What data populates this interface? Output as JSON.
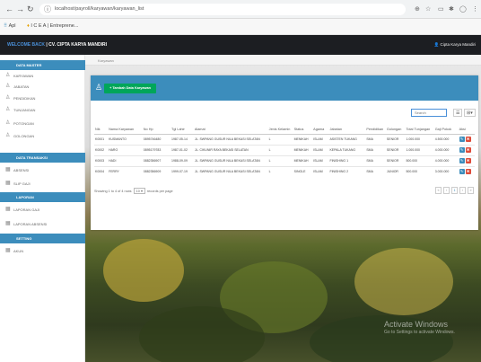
{
  "browser": {
    "url": "localhost/payroll/karyawan/karyawan_list",
    "bookmarks": [
      "Apl",
      "I C E A | Entreprene..."
    ]
  },
  "header": {
    "welcome": "WELCOME BACK",
    "company": "CV. CIPTA KARYA MANDIRI",
    "user": "Cipta Karya Mandiri"
  },
  "sidebar": {
    "sections": [
      {
        "label": "DATA MASTER",
        "items": [
          "KARYAWAN",
          "JABATAN",
          "PENDIDIKAN",
          "TUNJANGAN",
          "POTONGAN",
          "GOLONGAN"
        ]
      },
      {
        "label": "DATA TRANSAKSI",
        "items": [
          "ABSENSI",
          "SLIP GAJI"
        ]
      },
      {
        "label": "LAPORAN",
        "items": [
          "LAPORAN GAJI",
          "LAPORAN ABSENSI"
        ]
      },
      {
        "label": "SETTING",
        "items": [
          "AKUN"
        ]
      }
    ]
  },
  "breadcrumb": "Karyawan",
  "toolbar": {
    "add_label": "+ Tambah Data Karyawan",
    "search_placeholder": "Search"
  },
  "table": {
    "columns": [
      "Nik",
      "Nama Karyawan",
      "No Hp",
      "Tgl Lahir",
      "Alamat",
      "Jenis Kelamin",
      "Status",
      "Agama",
      "Jabatan",
      "Pendidikan",
      "Golongan",
      "Total Tunjangan",
      "Gaji Pokok",
      "Aksi"
    ],
    "rows": [
      [
        "K0001",
        "KUSMANTO",
        "0895746480",
        "1987-05-14",
        "JL. SWPANG GUSUR NILA BEKASI SELATAN",
        "L",
        "MENIKAH",
        "ISLAM",
        "ASISTEN TUKANG",
        "SMA",
        "SENIOR",
        "1.000.000",
        "4.500.000"
      ],
      [
        "K0002",
        "HARO",
        "0895179783",
        "1987-01-02",
        "JL. CIKUNIR RAYA BEKASI SELATAN",
        "L",
        "MENIKAH",
        "ISLAM",
        "KEPALA TUKANG",
        "SMA",
        "SENIOR",
        "1.000.000",
        "4.000.000"
      ],
      [
        "K0003",
        "HADI",
        "0882356907",
        "1988-09-09",
        "JL. SWPANG GUSUR NILA BEKASI SELATAN",
        "L",
        "MENIKAH",
        "ISLAM",
        "FINISHING 1",
        "SMA",
        "SENIOR",
        "500.000",
        "4.000.000"
      ],
      [
        "K0004",
        "FERRY",
        "0882356909",
        "1999-07-19",
        "JL. SWPANG GUSUR NILA BEKASI SELATAN",
        "L",
        "SINGLE",
        "ISLAM",
        "FINISHING 2",
        "SMA",
        "JUNIOR",
        "500.000",
        "3.000.000"
      ]
    ]
  },
  "footer": {
    "info_prefix": "Showing 1 to 4 of 4 rows",
    "page_size": "10",
    "info_suffix": "records per page",
    "pager": [
      "«",
      "‹",
      "1",
      "›",
      "»"
    ]
  },
  "watermark": {
    "line1": "Activate Windows",
    "line2": "Go to Settings to activate Windows."
  },
  "colors": {
    "header": "#1c1e22",
    "accent": "#3c8dbc",
    "add_button": "#00a65a",
    "delete_button": "#dd4b39"
  }
}
